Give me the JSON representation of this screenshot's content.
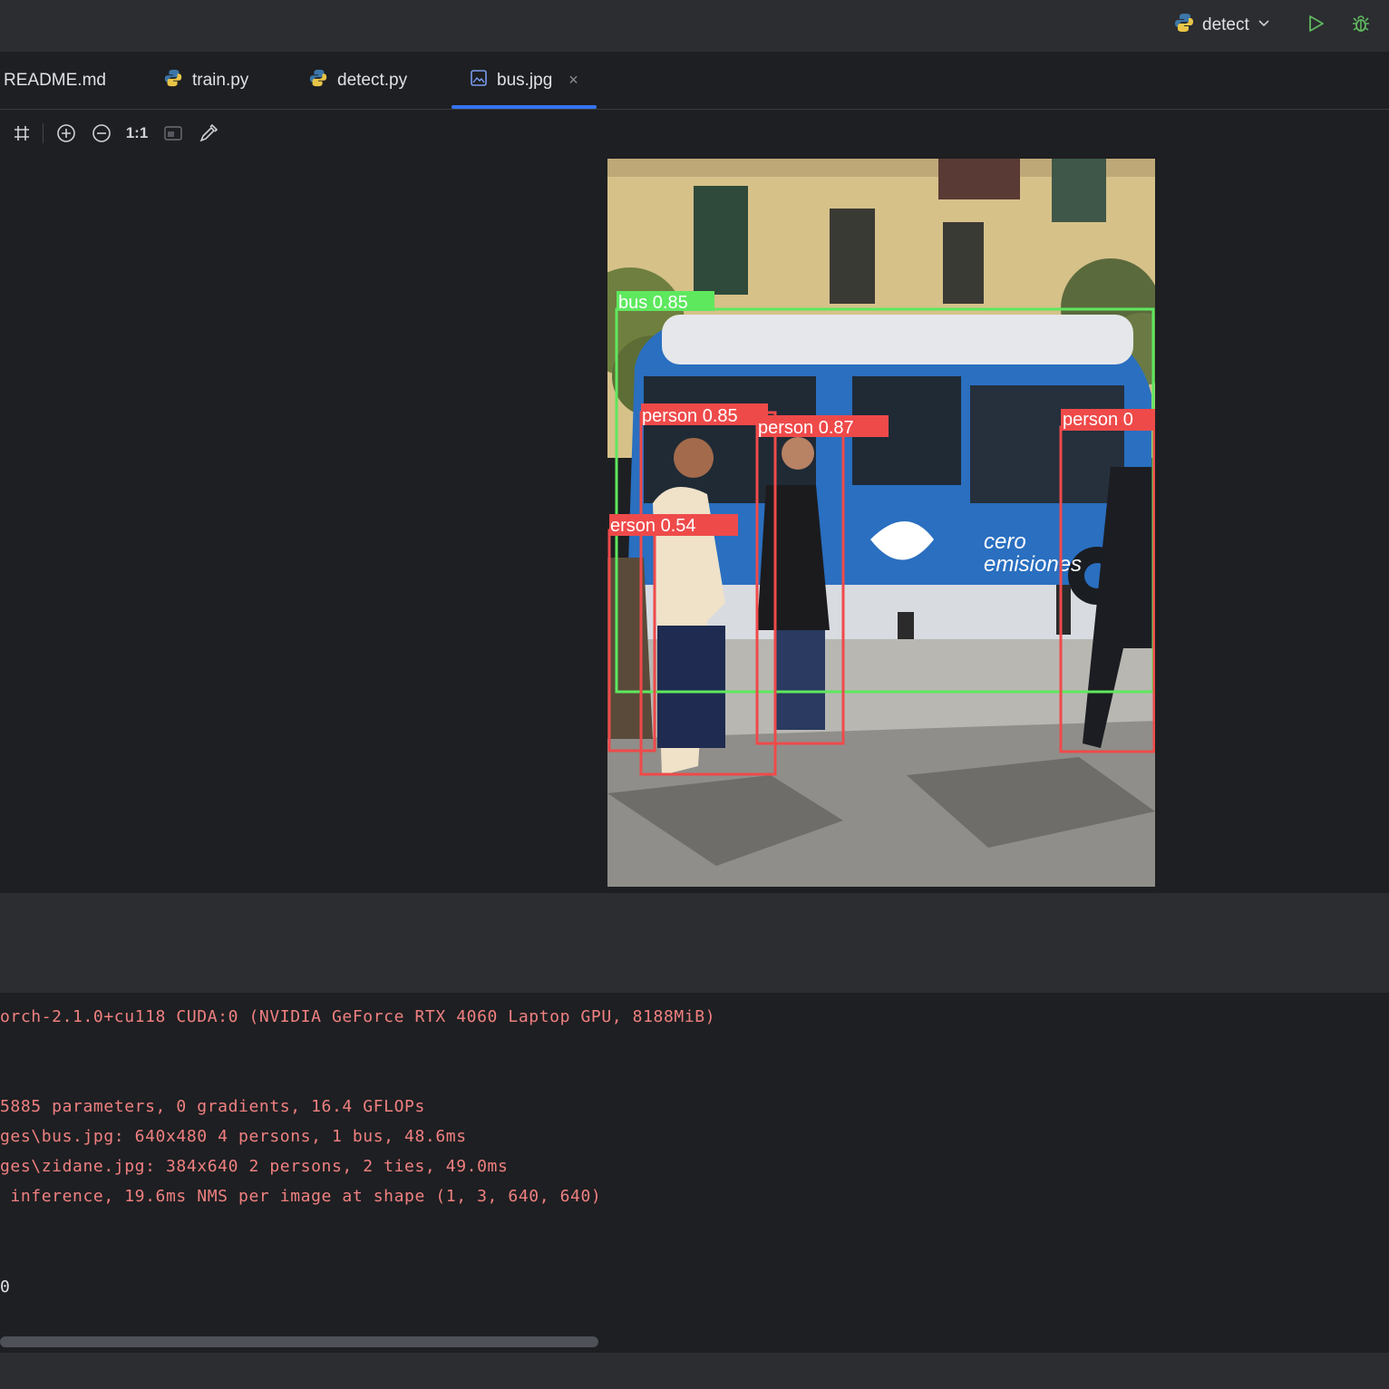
{
  "titlebar": {
    "run_config": "detect",
    "icons": {
      "python": "python-icon",
      "dropdown": "chevron-down-icon",
      "run": "run-icon",
      "debug": "debug-icon"
    }
  },
  "tabs": [
    {
      "label": "README.md",
      "icon": ""
    },
    {
      "label": "train.py",
      "icon": "python-icon"
    },
    {
      "label": "detect.py",
      "icon": "python-icon"
    },
    {
      "label": "bus.jpg",
      "icon": "image-icon",
      "active": true,
      "close": "×"
    }
  ],
  "toolbar": {
    "grid_icon": "grid-icon",
    "zoom_in_icon": "zoom-in-icon",
    "zoom_out_icon": "zoom-out-icon",
    "actual_size_label": "1:1",
    "fit_icon": "fit-icon",
    "color_picker_icon": "color-picker-icon"
  },
  "detections": [
    {
      "label": "bus 0.85",
      "color": "#5ee85e"
    },
    {
      "label": "person 0.85",
      "color": "#ef4a4a"
    },
    {
      "label": "person 0.87",
      "color": "#ef4a4a"
    },
    {
      "label": "erson 0.54",
      "color": "#ef4a4a"
    },
    {
      "label": "person 0",
      "color": "#ef4a4a"
    }
  ],
  "console": {
    "lines": [
      "orch-2.1.0+cu118 CUDA:0 (NVIDIA GeForce RTX 4060 Laptop GPU, 8188MiB)",
      "5885 parameters, 0 gradients, 16.4 GFLOPs",
      "ges\\bus.jpg: 640x480 4 persons, 1 bus, 48.6ms",
      "ges\\zidane.jpg: 384x640 2 persons, 2 ties, 49.0ms",
      " inference, 19.6ms NMS per image at shape (1, 3, 640, 640)",
      "0"
    ]
  }
}
